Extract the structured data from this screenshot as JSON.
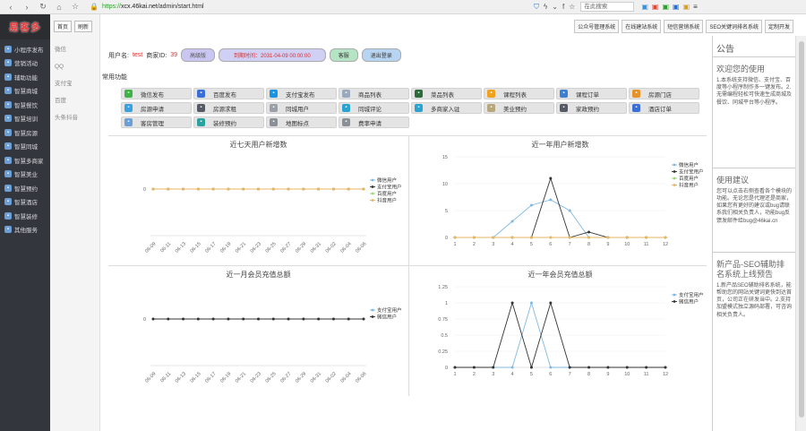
{
  "browser": {
    "url_proto": "https://",
    "url_host": "xcx.46kai.net",
    "url_path": "/admin/start.html",
    "search_placeholder": "在此搜索"
  },
  "logo": {
    "text": "易客多"
  },
  "sidebar": {
    "items": [
      {
        "label": "小程序发布",
        "icon": "grid-icon"
      },
      {
        "label": "营销活动",
        "icon": "gift-icon"
      },
      {
        "label": "辅助功能",
        "icon": "tool-icon"
      },
      {
        "label": "智慧商城",
        "icon": "cart-icon"
      },
      {
        "label": "智慧餐饮",
        "icon": "food-icon"
      },
      {
        "label": "智慧培训",
        "icon": "book-icon"
      },
      {
        "label": "智慧房源",
        "icon": "house-icon"
      },
      {
        "label": "智慧同城",
        "icon": "city-icon"
      },
      {
        "label": "智慧多商家",
        "icon": "store-icon"
      },
      {
        "label": "智慧美业",
        "icon": "beauty-icon"
      },
      {
        "label": "智慧预约",
        "icon": "calendar-icon"
      },
      {
        "label": "智慧酒店",
        "icon": "hotel-icon"
      },
      {
        "label": "智慧装修",
        "icon": "paint-icon"
      },
      {
        "label": "其他服务",
        "icon": "more-icon"
      }
    ]
  },
  "subcol": {
    "home_btn": "首页",
    "refresh_btn": "刷新",
    "links": [
      "微信",
      "QQ",
      "支付宝",
      "百度",
      "头条抖音"
    ]
  },
  "toplinks": [
    "公众号管理系统",
    "在线建站系统",
    "短信营销系统",
    "SEO关键词排名系统",
    "定制开发"
  ],
  "userbar": {
    "user_label": "用户名:",
    "user_name": "test",
    "merchant_label": "商家ID:",
    "merchant_id": "39",
    "level": "高级版",
    "expire": "到期时间：2031-04-09 00:00:00",
    "status": "客服",
    "logout": "退出登录"
  },
  "functions_title": "常用功能",
  "functions": [
    {
      "label": "微信发布",
      "color": "#3fb24a",
      "icon": "wechat-icon"
    },
    {
      "label": "百度发布",
      "color": "#3a6fd8",
      "icon": "baidu-icon"
    },
    {
      "label": "支付宝发布",
      "color": "#1a93e0",
      "icon": "alipay-icon"
    },
    {
      "label": "商品列表",
      "color": "#9aa9bd",
      "icon": "list-icon"
    },
    {
      "label": "菜品列表",
      "color": "#2d6b3a",
      "icon": "dish-icon"
    },
    {
      "label": "课程列表",
      "color": "#f0a21c",
      "icon": "course-icon"
    },
    {
      "label": "课程订单",
      "color": "#3a7fd0",
      "icon": "order-icon"
    },
    {
      "label": "房源门店",
      "color": "#e8922b",
      "icon": "house-icon"
    },
    {
      "label": "房源申请",
      "color": "#3aa0e0",
      "icon": "apply-icon"
    },
    {
      "label": "房源求租",
      "color": "#555a66",
      "icon": "rent-icon"
    },
    {
      "label": "同城用户",
      "color": "#9a9fa8",
      "icon": "user-icon"
    },
    {
      "label": "同城评论",
      "color": "#2aa3d0",
      "icon": "comment-icon"
    },
    {
      "label": "多商家入驻",
      "color": "#2aa3d0",
      "icon": "merchant-icon"
    },
    {
      "label": "美业预约",
      "color": "#b8a77a",
      "icon": "beauty-icon"
    },
    {
      "label": "家政预约",
      "color": "#555a66",
      "icon": "housework-icon"
    },
    {
      "label": "酒店订单",
      "color": "#3a6fd8",
      "icon": "hotel-icon"
    },
    {
      "label": "客房管理",
      "color": "#6b9fd6",
      "icon": "room-icon"
    },
    {
      "label": "装修预约",
      "color": "#2aa3a0",
      "icon": "decor-icon"
    },
    {
      "label": "地图标点",
      "color": "#8a8f98",
      "icon": "map-icon"
    },
    {
      "label": "费率申请",
      "color": "#8a8f98",
      "icon": "rate-icon"
    }
  ],
  "chart_data": [
    {
      "type": "line",
      "title": "近七天用户新增数",
      "categories": [
        "06-09",
        "06-11",
        "06-13",
        "06-15",
        "06-17",
        "06-19",
        "06-21",
        "06-23",
        "06-25",
        "06-27",
        "06-29",
        "06-31",
        "06-02",
        "06-04",
        "06-06"
      ],
      "ylim": [
        0,
        0
      ],
      "yticks": [
        "0"
      ],
      "series": [
        {
          "name": "微信用户",
          "color": "#7fb9e3",
          "values": [
            0,
            0,
            0,
            0,
            0,
            0,
            0,
            0,
            0,
            0,
            0,
            0,
            0,
            0,
            0
          ]
        },
        {
          "name": "支付宝用户",
          "color": "#333333",
          "values": [
            0,
            0,
            0,
            0,
            0,
            0,
            0,
            0,
            0,
            0,
            0,
            0,
            0,
            0,
            0
          ]
        },
        {
          "name": "百度用户",
          "color": "#9bd67a",
          "values": [
            0,
            0,
            0,
            0,
            0,
            0,
            0,
            0,
            0,
            0,
            0,
            0,
            0,
            0,
            0
          ]
        },
        {
          "name": "抖音用户",
          "color": "#e8b562",
          "values": [
            0,
            0,
            0,
            0,
            0,
            0,
            0,
            0,
            0,
            0,
            0,
            0,
            0,
            0,
            0
          ]
        }
      ]
    },
    {
      "type": "line",
      "title": "近一年用户新增数",
      "categories": [
        "1",
        "2",
        "3",
        "4",
        "5",
        "6",
        "7",
        "8",
        "9",
        "10",
        "11",
        "12"
      ],
      "ylim": [
        0,
        15
      ],
      "yticks": [
        "0",
        "5",
        "10",
        "15"
      ],
      "series": [
        {
          "name": "微信用户",
          "color": "#7fb9e3",
          "values": [
            0,
            0,
            0,
            3,
            6,
            7,
            5,
            0,
            0,
            0,
            0,
            0
          ]
        },
        {
          "name": "支付宝用户",
          "color": "#333333",
          "values": [
            0,
            0,
            0,
            0,
            0,
            11,
            0,
            1,
            0,
            0,
            0,
            0
          ]
        },
        {
          "name": "百度用户",
          "color": "#9bd67a",
          "values": [
            0,
            0,
            0,
            0,
            0,
            0,
            0,
            0,
            0,
            0,
            0,
            0
          ]
        },
        {
          "name": "抖音用户",
          "color": "#e8b562",
          "values": [
            0,
            0,
            0,
            0,
            0,
            0,
            0,
            0,
            0,
            0,
            0,
            0
          ]
        }
      ]
    },
    {
      "type": "line",
      "title": "近一月会员充值总额",
      "categories": [
        "06-09",
        "06-11",
        "06-13",
        "06-15",
        "06-17",
        "06-19",
        "06-21",
        "06-23",
        "06-25",
        "06-27",
        "06-29",
        "06-31",
        "06-02",
        "06-04",
        "06-06"
      ],
      "ylim": [
        0,
        0
      ],
      "yticks": [
        "0"
      ],
      "series": [
        {
          "name": "支付宝用户",
          "color": "#7fb9e3",
          "values": [
            0,
            0,
            0,
            0,
            0,
            0,
            0,
            0,
            0,
            0,
            0,
            0,
            0,
            0,
            0
          ]
        },
        {
          "name": "微信用户",
          "color": "#333333",
          "values": [
            0,
            0,
            0,
            0,
            0,
            0,
            0,
            0,
            0,
            0,
            0,
            0,
            0,
            0,
            0
          ]
        }
      ]
    },
    {
      "type": "line",
      "title": "近一年会员充值总额",
      "categories": [
        "1",
        "2",
        "3",
        "4",
        "5",
        "6",
        "7",
        "8",
        "9",
        "10",
        "11",
        "12"
      ],
      "ylim": [
        0,
        1.25
      ],
      "yticks": [
        "0",
        "0.25",
        "0.5",
        "0.75",
        "1",
        "1.25"
      ],
      "series": [
        {
          "name": "支付宝用户",
          "color": "#7fb9e3",
          "values": [
            0,
            0,
            0,
            0,
            1,
            0,
            0,
            0,
            0,
            0,
            0,
            0
          ]
        },
        {
          "name": "微信用户",
          "color": "#333333",
          "values": [
            0,
            0,
            0,
            1,
            0,
            1,
            0,
            0,
            0,
            0,
            0,
            0
          ]
        }
      ]
    }
  ],
  "rpanel": {
    "title": "公告",
    "s1_title": "欢迎您的使用",
    "s1_text": "1.本系统支持微信、支付宝、百度等小程序制作多一键发布。2.无需编程轻松可快速生成商城及餐饮、同城平台等小程序。",
    "s2_title": "使用建议",
    "s2_text": "您可以点击右侧查看各个模块的功能。无论您是代理还是商家，如果您有更好的建议或bug请联系我们相关负责人，功能bug反馈发邮件给bug@46kai.cn",
    "s3_title": "新产品-SEO辅助排名系统上线预告",
    "s3_text": "1.新产品SEO辅助排名系统，能帮助您的网站关键词更快到达首页，公司正在研发当中。2.支持加盟模式独立源码部署，可咨询相关负责人。"
  }
}
